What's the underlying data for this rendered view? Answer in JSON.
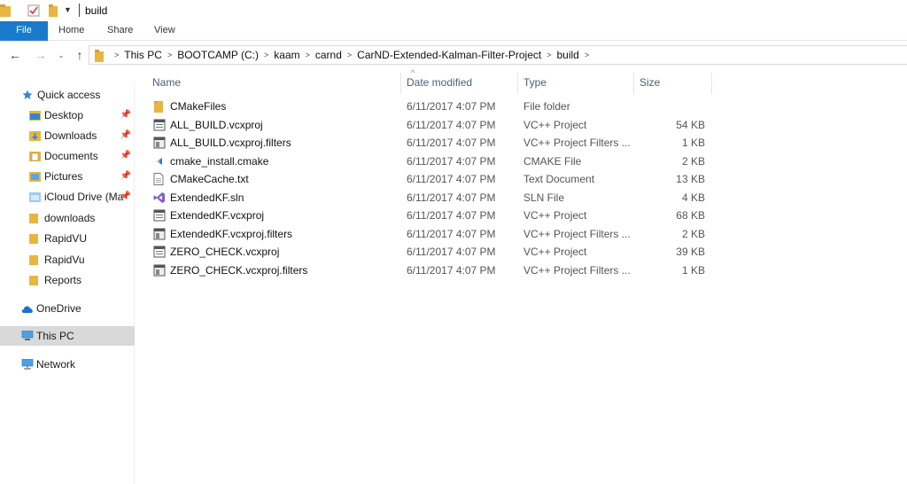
{
  "window": {
    "title": "build"
  },
  "quick_access_toolbar": {
    "icons": [
      "folder-icon",
      "properties-icon",
      "new-folder-icon",
      "dropdown-icon"
    ]
  },
  "ribbon": {
    "tabs": [
      {
        "label": "File"
      },
      {
        "label": "Home"
      },
      {
        "label": "Share"
      },
      {
        "label": "View"
      }
    ]
  },
  "address": {
    "breadcrumbs": [
      "This PC",
      "BOOTCAMP (C:)",
      "kaam",
      "carnd",
      "CarND-Extended-Kalman-Filter-Project",
      "build"
    ]
  },
  "sidebar": {
    "quick_access": "Quick access",
    "items": [
      {
        "label": "Desktop",
        "icon": "desktop-icon",
        "pinned": true
      },
      {
        "label": "Downloads",
        "icon": "downloads-icon",
        "pinned": true
      },
      {
        "label": "Documents",
        "icon": "documents-icon",
        "pinned": true
      },
      {
        "label": "Pictures",
        "icon": "pictures-icon",
        "pinned": true
      },
      {
        "label": "iCloud Drive (Ma",
        "icon": "icloud-icon",
        "pinned": true
      },
      {
        "label": "downloads",
        "icon": "folder-icon",
        "pinned": false
      },
      {
        "label": "RapidVU",
        "icon": "folder-icon",
        "pinned": false
      },
      {
        "label": "RapidVu",
        "icon": "folder-icon",
        "pinned": false
      },
      {
        "label": "Reports",
        "icon": "folder-icon",
        "pinned": false
      }
    ],
    "onedrive": "OneDrive",
    "this_pc": "This PC",
    "network": "Network"
  },
  "columns": {
    "name": "Name",
    "date": "Date modified",
    "type": "Type",
    "size": "Size"
  },
  "files": [
    {
      "name": "CMakeFiles",
      "date": "6/11/2017 4:07 PM",
      "type": "File folder",
      "size": "",
      "icon": "folder-icon"
    },
    {
      "name": "ALL_BUILD.vcxproj",
      "date": "6/11/2017 4:07 PM",
      "type": "VC++ Project",
      "size": "54 KB",
      "icon": "vcxproj-icon"
    },
    {
      "name": "ALL_BUILD.vcxproj.filters",
      "date": "6/11/2017 4:07 PM",
      "type": "VC++ Project Filters ...",
      "size": "1 KB",
      "icon": "filters-icon"
    },
    {
      "name": "cmake_install.cmake",
      "date": "6/11/2017 4:07 PM",
      "type": "CMAKE File",
      "size": "2 KB",
      "icon": "cmake-icon"
    },
    {
      "name": "CMakeCache.txt",
      "date": "6/11/2017 4:07 PM",
      "type": "Text Document",
      "size": "13 KB",
      "icon": "text-file-icon"
    },
    {
      "name": "ExtendedKF.sln",
      "date": "6/11/2017 4:07 PM",
      "type": "SLN File",
      "size": "4 KB",
      "icon": "visual-studio-icon"
    },
    {
      "name": "ExtendedKF.vcxproj",
      "date": "6/11/2017 4:07 PM",
      "type": "VC++ Project",
      "size": "68 KB",
      "icon": "vcxproj-icon"
    },
    {
      "name": "ExtendedKF.vcxproj.filters",
      "date": "6/11/2017 4:07 PM",
      "type": "VC++ Project Filters ...",
      "size": "2 KB",
      "icon": "filters-icon"
    },
    {
      "name": "ZERO_CHECK.vcxproj",
      "date": "6/11/2017 4:07 PM",
      "type": "VC++ Project",
      "size": "39 KB",
      "icon": "vcxproj-icon"
    },
    {
      "name": "ZERO_CHECK.vcxproj.filters",
      "date": "6/11/2017 4:07 PM",
      "type": "VC++ Project Filters ...",
      "size": "1 KB",
      "icon": "filters-icon"
    }
  ],
  "colors": {
    "accent": "#1979ca",
    "folder": "#e8b53e",
    "selected_nav": "#d9d9d9",
    "header_text": "#4c607a"
  }
}
